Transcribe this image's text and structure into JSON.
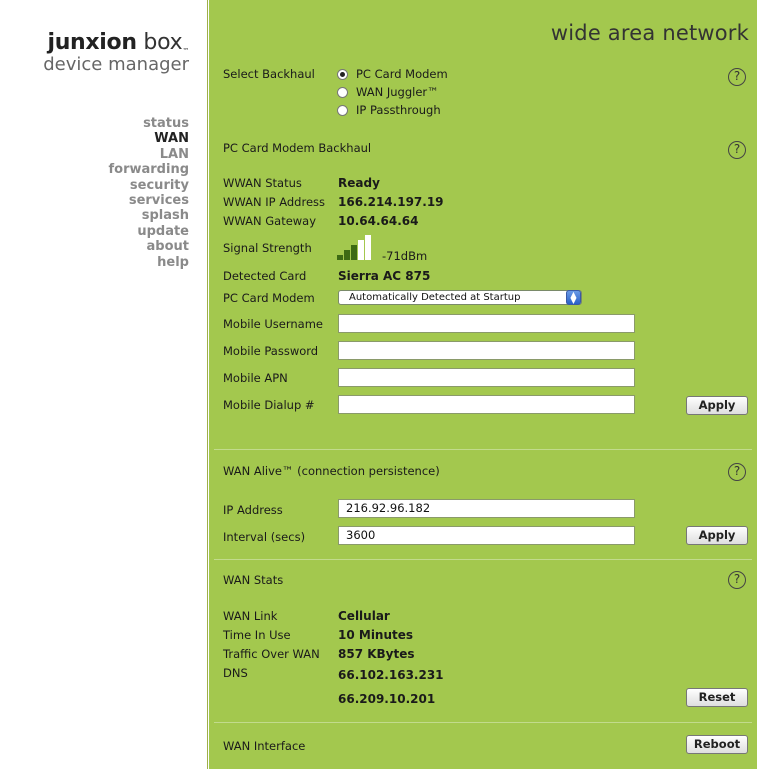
{
  "brand": {
    "name_bold": "junxion",
    "name_rest": " box",
    "trademark": "™",
    "subtitle": "device manager"
  },
  "nav": [
    "status",
    "WAN",
    "LAN",
    "forwarding",
    "security",
    "services",
    "splash",
    "update",
    "about",
    "help"
  ],
  "page_title": "wide area network",
  "help_glyph": "?",
  "backhaul": {
    "label": "Select Backhaul",
    "options": [
      "PC Card Modem",
      "WAN Juggler™",
      "IP Passthrough"
    ],
    "selected": "PC Card Modem"
  },
  "pc_card": {
    "heading": "PC Card Modem Backhaul",
    "status_label": "WWAN Status",
    "status_value": "Ready",
    "ip_label": "WWAN IP Address",
    "ip_value": "166.214.197.19",
    "gateway_label": "WWAN Gateway",
    "gateway_value": "10.64.64.64",
    "signal_label": "Signal Strength",
    "signal_value": "-71dBm",
    "signal_level": 3,
    "signal_max": 5,
    "card_label": "Detected Card",
    "card_value": "Sierra AC 875",
    "modem_label": "PC Card Modem",
    "modem_selected": "Automatically Detected at Startup",
    "username_label": "Mobile Username",
    "username_value": "",
    "password_label": "Mobile Password",
    "password_value": "",
    "apn_label": "Mobile APN",
    "apn_value": "",
    "dialup_label": "Mobile Dialup #",
    "dialup_value": "",
    "apply_label": "Apply"
  },
  "wan_alive": {
    "heading": "WAN Alive™ (connection persistence)",
    "ip_label": "IP Address",
    "ip_value": "216.92.96.182",
    "interval_label": "Interval (secs)",
    "interval_value": "3600",
    "apply_label": "Apply"
  },
  "wan_stats": {
    "heading": "WAN Stats",
    "link_label": "WAN Link",
    "link_value": "Cellular",
    "time_label": "Time In Use",
    "time_value": "10 Minutes",
    "traffic_label": "Traffic Over WAN",
    "traffic_value": "857 KBytes",
    "dns_label": "DNS",
    "dns_values": [
      "66.102.163.231",
      "66.209.10.201"
    ],
    "reset_label": "Reset"
  },
  "wan_interface": {
    "heading": "WAN Interface",
    "reboot_label": "Reboot"
  },
  "colors": {
    "panel": "#a3c84e",
    "nav_active": "#222222",
    "nav_inactive": "#8a8a8a",
    "signal_on": "#3d6a14",
    "signal_off": "#ffffff"
  }
}
